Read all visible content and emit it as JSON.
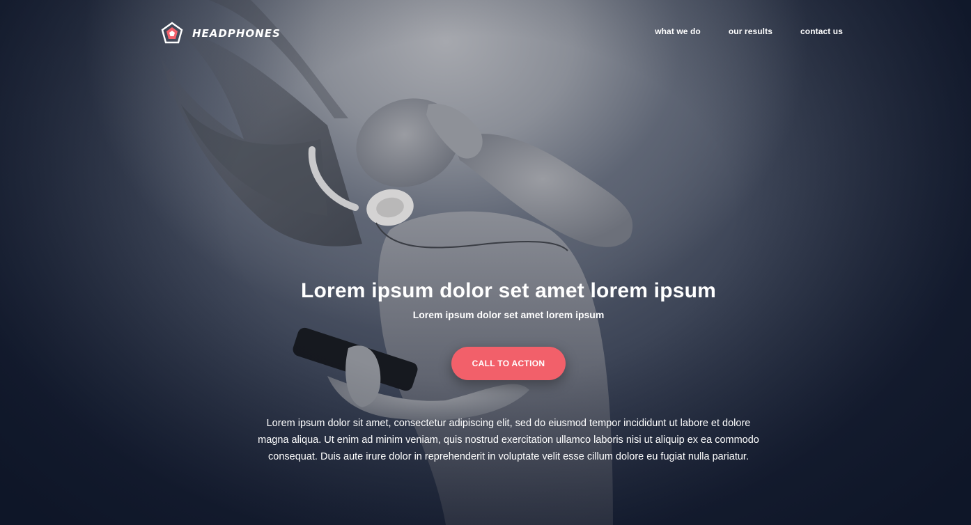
{
  "brand": {
    "name": "HEADPHONES",
    "logo_icon": "pentagon-logo-icon",
    "accent_color": "#f2606a"
  },
  "nav": {
    "items": [
      {
        "label": "what we do"
      },
      {
        "label": "our results"
      },
      {
        "label": "contact us"
      }
    ]
  },
  "hero": {
    "headline": "Lorem ipsum dolor set amet lorem ipsum",
    "subheadline": "Lorem ipsum dolor set amet lorem ipsum",
    "cta_label": "CALL TO ACTION",
    "body": "Lorem ipsum dolor sit amet, consectetur adipiscing elit, sed do eiusmod tempor incididunt ut labore et dolore magna aliqua. Ut enim ad minim veniam, quis nostrud exercitation ullamco laboris nisi ut aliquip ex ea commodo consequat. Duis aute irure dolor in reprehenderit in voluptate velit esse cillum dolore eu fugiat nulla pariatur."
  }
}
